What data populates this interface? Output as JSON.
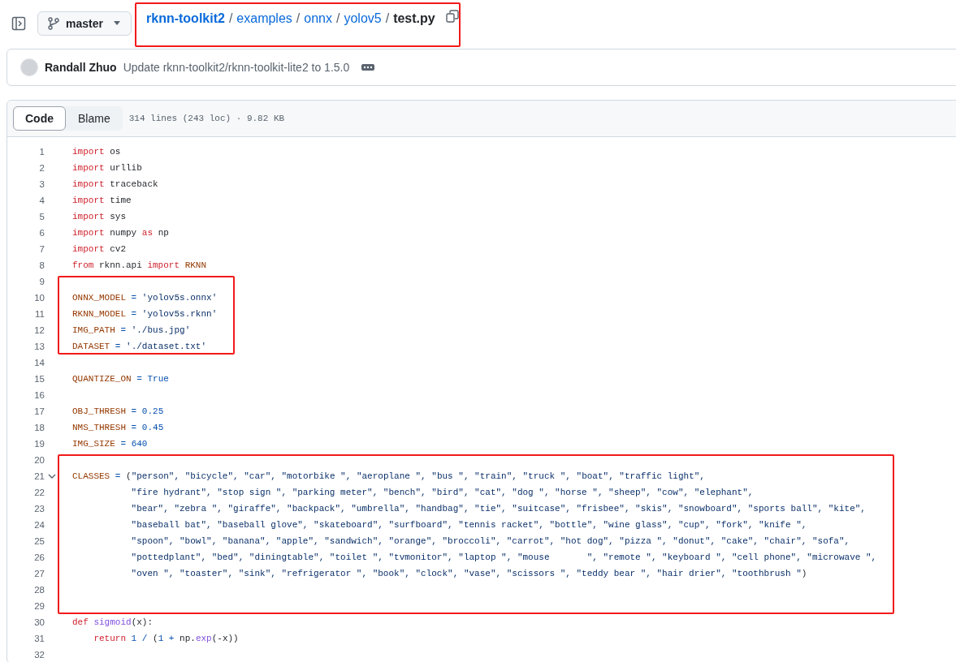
{
  "header": {
    "branch": {
      "label": "master"
    },
    "breadcrumb": {
      "annotated": true,
      "items": [
        {
          "kind": "repo",
          "text": "rknn-toolkit2"
        },
        {
          "kind": "sep",
          "text": "/"
        },
        {
          "kind": "link",
          "text": "examples"
        },
        {
          "kind": "sep",
          "text": "/"
        },
        {
          "kind": "link",
          "text": "onnx"
        },
        {
          "kind": "sep",
          "text": "/"
        },
        {
          "kind": "link",
          "text": "yolov5"
        },
        {
          "kind": "sep",
          "text": "/"
        },
        {
          "kind": "current",
          "text": "test.py"
        }
      ]
    }
  },
  "commit": {
    "author": "Randall Zhuo",
    "message": "Update rknn-toolkit2/rknn-toolkit-lite2 to 1.5.0"
  },
  "file": {
    "tabs": [
      {
        "label": "Code",
        "selected": true
      },
      {
        "label": "Blame",
        "selected": false
      }
    ],
    "info": "314 lines (243 loc) · 9.82 KB",
    "sections": [
      {
        "annotated": false,
        "lines": [
          {
            "number": "1",
            "tokens": [
              {
                "kind": "kw",
                "text": "import"
              },
              {
                "kind": "plain",
                "text": " os"
              }
            ]
          },
          {
            "number": "2",
            "tokens": [
              {
                "kind": "kw",
                "text": "import"
              },
              {
                "kind": "plain",
                "text": " urllib"
              }
            ]
          },
          {
            "number": "3",
            "tokens": [
              {
                "kind": "kw",
                "text": "import"
              },
              {
                "kind": "plain",
                "text": " traceback"
              }
            ]
          },
          {
            "number": "4",
            "tokens": [
              {
                "kind": "kw",
                "text": "import"
              },
              {
                "kind": "plain",
                "text": " time"
              }
            ]
          },
          {
            "number": "5",
            "tokens": [
              {
                "kind": "kw",
                "text": "import"
              },
              {
                "kind": "plain",
                "text": " sys"
              }
            ]
          },
          {
            "number": "6",
            "tokens": [
              {
                "kind": "kw",
                "text": "import"
              },
              {
                "kind": "plain",
                "text": " numpy "
              },
              {
                "kind": "kw",
                "text": "as"
              },
              {
                "kind": "plain",
                "text": " np"
              }
            ]
          },
          {
            "number": "7",
            "tokens": [
              {
                "kind": "kw",
                "text": "import"
              },
              {
                "kind": "plain",
                "text": " cv2"
              }
            ]
          },
          {
            "number": "8",
            "tokens": [
              {
                "kind": "kw",
                "text": "from"
              },
              {
                "kind": "plain",
                "text": " rknn.api "
              },
              {
                "kind": "kw",
                "text": "import"
              },
              {
                "kind": "var",
                "text": " RKNN"
              }
            ]
          },
          {
            "number": "9"
          }
        ]
      },
      {
        "annotated": true,
        "lines": [
          {
            "number": "10",
            "tokens": [
              {
                "kind": "var",
                "text": "ONNX_MODEL"
              },
              {
                "kind": "op",
                "text": " = "
              },
              {
                "kind": "str",
                "text": "'yolov5s.onnx'"
              }
            ]
          },
          {
            "number": "11",
            "tokens": [
              {
                "kind": "var",
                "text": "RKNN_MODEL"
              },
              {
                "kind": "op",
                "text": " = "
              },
              {
                "kind": "str",
                "text": "'yolov5s.rknn'"
              }
            ]
          },
          {
            "number": "12",
            "tokens": [
              {
                "kind": "var",
                "text": "IMG_PATH"
              },
              {
                "kind": "op",
                "text": " = "
              },
              {
                "kind": "str",
                "text": "'./bus.jpg'"
              }
            ]
          },
          {
            "number": "13",
            "tokens": [
              {
                "kind": "var",
                "text": "DATASET"
              },
              {
                "kind": "op",
                "text": " = "
              },
              {
                "kind": "str",
                "text": "'./dataset.txt'"
              }
            ]
          }
        ]
      },
      {
        "annotated": false,
        "lines": [
          {
            "number": "14"
          },
          {
            "number": "15",
            "tokens": [
              {
                "kind": "var",
                "text": "QUANTIZE_ON"
              },
              {
                "kind": "op",
                "text": " = "
              },
              {
                "kind": "num",
                "text": "True"
              }
            ]
          },
          {
            "number": "16"
          },
          {
            "number": "17",
            "tokens": [
              {
                "kind": "var",
                "text": "OBJ_THRESH"
              },
              {
                "kind": "op",
                "text": " = "
              },
              {
                "kind": "num",
                "text": "0.25"
              }
            ]
          },
          {
            "number": "18",
            "tokens": [
              {
                "kind": "var",
                "text": "NMS_THRESH"
              },
              {
                "kind": "op",
                "text": " = "
              },
              {
                "kind": "num",
                "text": "0.45"
              }
            ]
          },
          {
            "number": "19",
            "tokens": [
              {
                "kind": "var",
                "text": "IMG_SIZE"
              },
              {
                "kind": "op",
                "text": " = "
              },
              {
                "kind": "num",
                "text": "640"
              }
            ]
          },
          {
            "number": "20"
          }
        ]
      },
      {
        "annotated": true,
        "lines": [
          {
            "number": "21",
            "expanded": true,
            "tokens": [
              {
                "kind": "var",
                "text": "CLASSES"
              },
              {
                "kind": "op",
                "text": " = "
              },
              {
                "kind": "plain",
                "text": "("
              },
              {
                "kind": "str",
                "text": "\"person\", \"bicycle\", \"car\", \"motorbike \", \"aeroplane \", \"bus \", \"train\", \"truck \", \"boat\", \"traffic light\","
              }
            ]
          },
          {
            "number": "22",
            "tokens": [
              {
                "kind": "str",
                "text": "           \"fire hydrant\", \"stop sign \", \"parking meter\", \"bench\", \"bird\", \"cat\", \"dog \", \"horse \", \"sheep\", \"cow\", \"elephant\","
              }
            ]
          },
          {
            "number": "23",
            "tokens": [
              {
                "kind": "str",
                "text": "           \"bear\", \"zebra \", \"giraffe\", \"backpack\", \"umbrella\", \"handbag\", \"tie\", \"suitcase\", \"frisbee\", \"skis\", \"snowboard\", \"sports ball\", \"kite\","
              }
            ]
          },
          {
            "number": "24",
            "tokens": [
              {
                "kind": "str",
                "text": "           \"baseball bat\", \"baseball glove\", \"skateboard\", \"surfboard\", \"tennis racket\", \"bottle\", \"wine glass\", \"cup\", \"fork\", \"knife \","
              }
            ]
          },
          {
            "number": "25",
            "tokens": [
              {
                "kind": "str",
                "text": "           \"spoon\", \"bowl\", \"banana\", \"apple\", \"sandwich\", \"orange\", \"broccoli\", \"carrot\", \"hot dog\", \"pizza \", \"donut\", \"cake\", \"chair\", \"sofa\","
              }
            ]
          },
          {
            "number": "26",
            "tokens": [
              {
                "kind": "str",
                "text": "           \"pottedplant\", \"bed\", \"diningtable\", \"toilet \", \"tvmonitor\", \"laptop \", \"mouse       \", \"remote \", \"keyboard \", \"cell phone\", \"microwave \","
              }
            ]
          },
          {
            "number": "27",
            "tokens": [
              {
                "kind": "str",
                "text": "           \"oven \", \"toaster\", \"sink\", \"refrigerator \", \"book\", \"clock\", \"vase\", \"scissors \", \"teddy bear \", \"hair drier\", \"toothbrush \""
              },
              {
                "kind": "plain",
                "text": ")"
              }
            ]
          },
          {
            "number": "28"
          },
          {
            "number": "29"
          }
        ]
      },
      {
        "annotated": false,
        "lines": [
          {
            "number": "30",
            "tokens": [
              {
                "kind": "kw",
                "text": "def "
              },
              {
                "kind": "fn",
                "text": "sigmoid"
              },
              {
                "kind": "plain",
                "text": "(x):"
              }
            ]
          },
          {
            "number": "31",
            "tokens": [
              {
                "kind": "kw",
                "text": "    return"
              },
              {
                "kind": "num",
                "text": " 1"
              },
              {
                "kind": "op",
                "text": " / "
              },
              {
                "kind": "plain",
                "text": "("
              },
              {
                "kind": "num",
                "text": "1"
              },
              {
                "kind": "op",
                "text": " + "
              },
              {
                "kind": "plain",
                "text": "np."
              },
              {
                "kind": "fn",
                "text": "exp"
              },
              {
                "kind": "plain",
                "text": "(-x))"
              }
            ]
          },
          {
            "number": "32"
          }
        ]
      }
    ]
  }
}
